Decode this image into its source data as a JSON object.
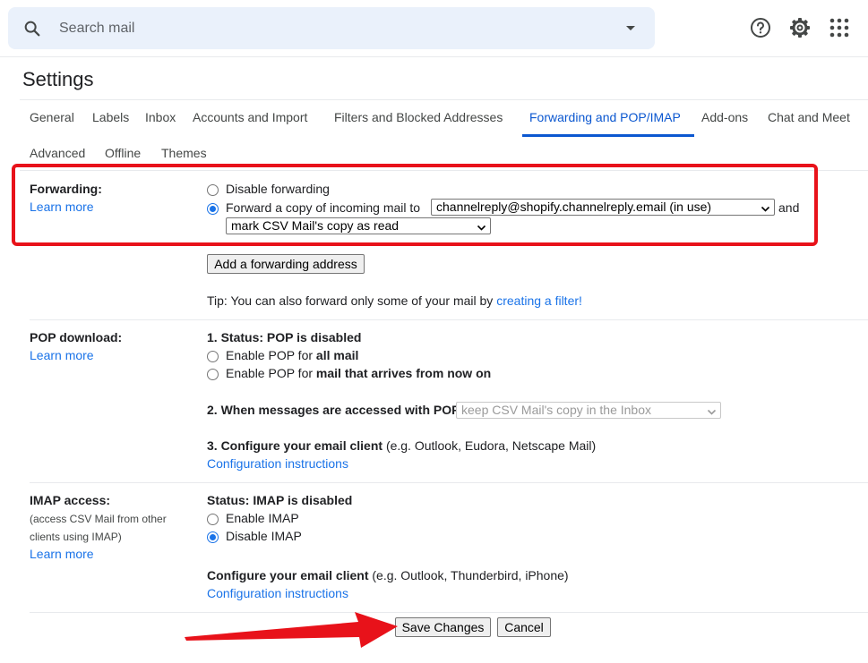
{
  "search": {
    "placeholder": "Search mail",
    "icon": "search-icon"
  },
  "toolbar": {
    "icons": [
      "help-icon",
      "gear-icon",
      "apps-icon"
    ]
  },
  "page_title": "Settings",
  "tabs": [
    {
      "label": "General",
      "active": false
    },
    {
      "label": "Labels",
      "active": false
    },
    {
      "label": "Inbox",
      "active": false
    },
    {
      "label": "Accounts and Import",
      "active": false
    },
    {
      "label": "Filters and Blocked Addresses",
      "active": false
    },
    {
      "label": "Forwarding and POP/IMAP",
      "active": true
    },
    {
      "label": "Add-ons",
      "active": false
    },
    {
      "label": "Chat and Meet",
      "active": false
    },
    {
      "label": "Advanced",
      "active": false
    },
    {
      "label": "Offline",
      "active": false
    },
    {
      "label": "Themes",
      "active": false
    }
  ],
  "forwarding": {
    "label": "Forwarding:",
    "learn_more": "Learn more",
    "disable_option": "Disable forwarding",
    "forward_option": "Forward a copy of incoming mail to",
    "forward_selected": true,
    "address_value": "channelreply@shopify.channelreply.email (in use)",
    "and_text": "and",
    "action_value": "mark CSV Mail's copy as read",
    "add_address_button": "Add a forwarding address",
    "tip_text": "Tip: You can also forward only some of your mail by",
    "tip_link": "creating a filter!"
  },
  "pop": {
    "label": "POP download:",
    "learn_more": "Learn more",
    "status": "1. Status: POP is disabled",
    "all_mail_prefix": "Enable POP for",
    "all_mail_bold": "all mail",
    "now_on_prefix": "Enable POP for",
    "now_on_bold": "mail that arrives from now on",
    "when_accessed": "2. When messages are accessed with POP",
    "when_accessed_value": "keep CSV Mail's copy in the Inbox",
    "configure": "3. Configure your email client",
    "configure_hint": "(e.g. Outlook, Eudora, Netscape Mail)",
    "config_link": "Configuration instructions"
  },
  "imap": {
    "label": "IMAP access:",
    "sub1": "(access CSV Mail from other",
    "sub2": "clients using IMAP)",
    "learn_more": "Learn more",
    "status": "Status: IMAP is disabled",
    "enable": "Enable IMAP",
    "disable": "Disable IMAP",
    "disable_selected": true,
    "configure": "Configure your email client",
    "configure_hint": "(e.g. Outlook, Thunderbird, iPhone)",
    "config_link": "Configuration instructions"
  },
  "actions": {
    "save": "Save Changes",
    "cancel": "Cancel"
  },
  "colors": {
    "accent": "#0b57d0",
    "link": "#1a73e8",
    "highlight": "#e8121a"
  }
}
